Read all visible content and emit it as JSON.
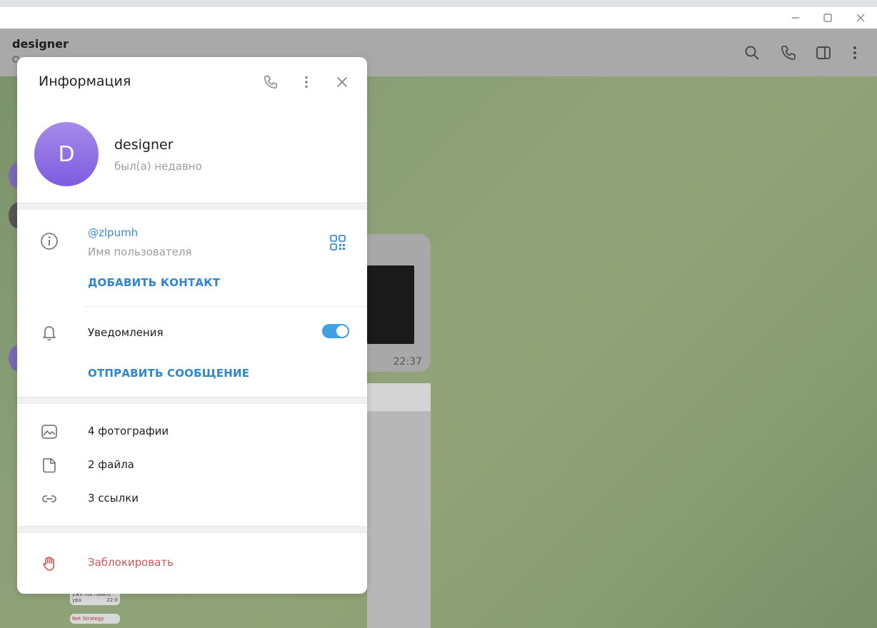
{
  "chat": {
    "title": "designer",
    "bubble_time": "22:37",
    "mini_bubble_1": "уже поставил) ура",
    "mini_bubble_1_time": "22:0",
    "mini_bubble_2": "Net Strategy"
  },
  "panel": {
    "title": "Информация",
    "name": "designer",
    "status": "был(а) недавно",
    "avatar_letter": "D",
    "avatar_gradient": [
      "#a68ae9",
      "#7d5ce0"
    ],
    "username": "@zlpumh",
    "username_label": "Имя пользователя",
    "add_contact": "ДОБАВИТЬ КОНТАКТ",
    "notifications_label": "Уведомления",
    "notifications_enabled": true,
    "send_message": "ОТПРАВИТЬ СООБЩЕНИЕ",
    "media": [
      {
        "label": "4 фотографии",
        "icon": "photo-icon"
      },
      {
        "label": "2 файла",
        "icon": "file-icon"
      },
      {
        "label": "3 ссылки",
        "icon": "link-icon"
      }
    ],
    "block": "Заблокировать"
  },
  "colors": {
    "accent": "#3c8ad1",
    "toggle_on": "#42a1e2",
    "danger": "#d05656"
  }
}
